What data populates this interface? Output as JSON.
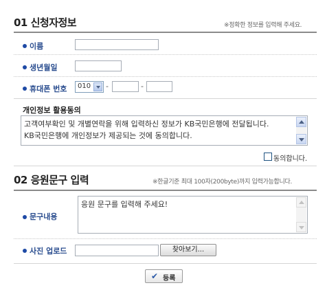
{
  "section1": {
    "number": "01",
    "title": "신청자정보",
    "note": "※정확한 정보를 입력해 주세요."
  },
  "fields": {
    "name_label": "이름",
    "name_value": "",
    "birth_label": "생년월일",
    "birth_value": "",
    "phone_label": "휴대폰 번호",
    "phone_prefix": "010",
    "phone_mid": "",
    "phone_last": "",
    "dash": "-"
  },
  "consent": {
    "title": "개인정보 활용동의",
    "text": "고객여부확인 및 개별연락을 위해 입력하신 정보가 KB국민은행에 전달됩니다.\nKB국민은행에 개인정보가 제공되는 것에 동의합니다.",
    "agree_label": "동의합니다."
  },
  "section2": {
    "number": "02",
    "title": "응원문구 입력",
    "note": "※한글기준 최대 100자(200byte)까지 입력가능합니다."
  },
  "message": {
    "label": "문구내용",
    "placeholder": "응원 문구를 입력해 주세요!"
  },
  "photo": {
    "label": "사진 업로드",
    "value": "",
    "browse_label": "찾아보기..."
  },
  "submit": {
    "label": "등록"
  },
  "colors": {
    "label_blue": "#2a4d8f",
    "bullet_blue": "#1e4aa5"
  }
}
